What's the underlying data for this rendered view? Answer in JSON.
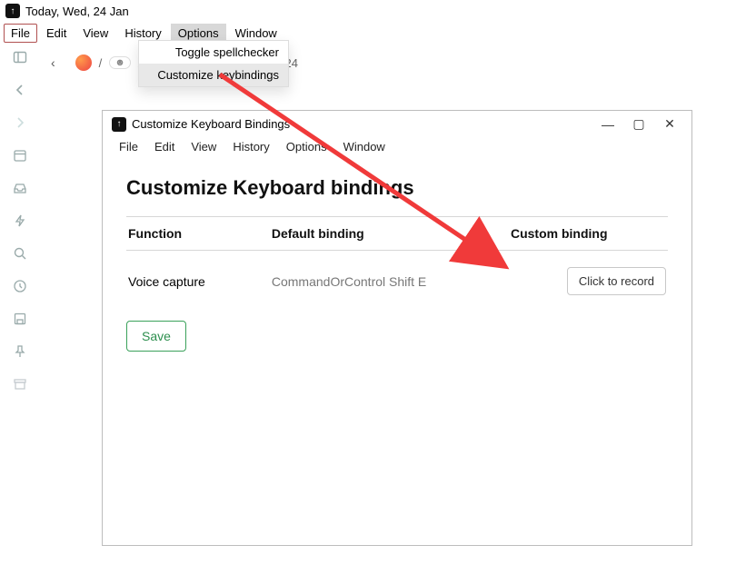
{
  "titlebar": {
    "title": "Today, Wed, 24 Jan"
  },
  "menubar": [
    "File",
    "Edit",
    "View",
    "History",
    "Options",
    "Window"
  ],
  "dropdown": {
    "items": [
      "Toggle spellchecker",
      "Customize keybindings"
    ]
  },
  "crumbs": {
    "tail": "24"
  },
  "dialog": {
    "title": "Customize Keyboard Bindings",
    "menubar": [
      "File",
      "Edit",
      "View",
      "History",
      "Options",
      "Window"
    ],
    "heading": "Customize Keyboard bindings",
    "columns": {
      "function": "Function",
      "default": "Default binding",
      "custom": "Custom binding"
    },
    "rows": [
      {
        "function": "Voice capture",
        "default": "CommandOrControl Shift E",
        "custom_button": "Click to record"
      }
    ],
    "save": "Save",
    "window_controls": {
      "minimize": "—",
      "maximize": "▢",
      "close": "✕"
    }
  }
}
